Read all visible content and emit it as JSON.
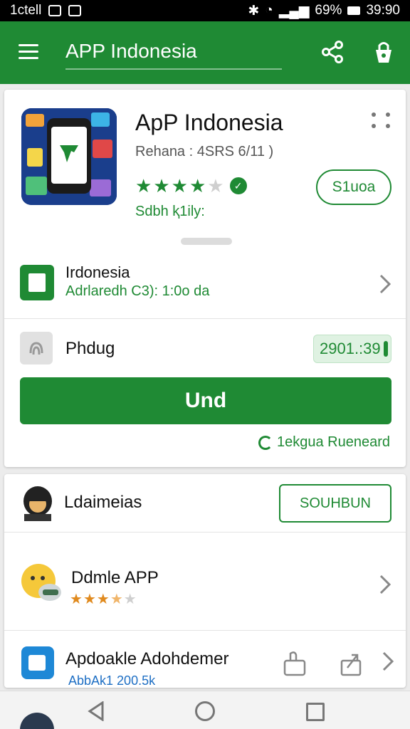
{
  "status_bar": {
    "carrier": "1ctell",
    "battery": "69%",
    "time": "39:90"
  },
  "app_bar": {
    "title": "APP Indonesia"
  },
  "app_header": {
    "name": "ApP Indonesia",
    "version": "Rehana : 4SRS 6/11 )",
    "rating": 4.5,
    "subtitle": "Sdbh ⱪ1ily:",
    "status_button": "S1uoa"
  },
  "info_row": {
    "title": "Irdonesia",
    "subtitle": "Adrlaredh C3): 1:0o da"
  },
  "phdug_row": {
    "label": "Phdug",
    "size": "2901.:39"
  },
  "install_button": "Und",
  "report_link": "1ekgua Rueneard",
  "developer": {
    "name": "Ldaimeias",
    "follow_button": "SOUHBUN"
  },
  "app2": {
    "name": "Ddmle APP",
    "rating": 3.5
  },
  "app3": {
    "name": "Apdoakle Adohdemer",
    "sub": "AbbAk1  200.5k"
  },
  "colors": {
    "brand": "#1f8a34",
    "star_orange": "#e08a1e",
    "link_blue": "#1e6fc4"
  },
  "icons": [
    "menu-icon",
    "share-icon",
    "bag-icon",
    "more-icon",
    "verified-icon",
    "chevron-right-icon",
    "fingerprint-icon",
    "refresh-icon",
    "back-icon",
    "home-icon",
    "recent-icon"
  ]
}
